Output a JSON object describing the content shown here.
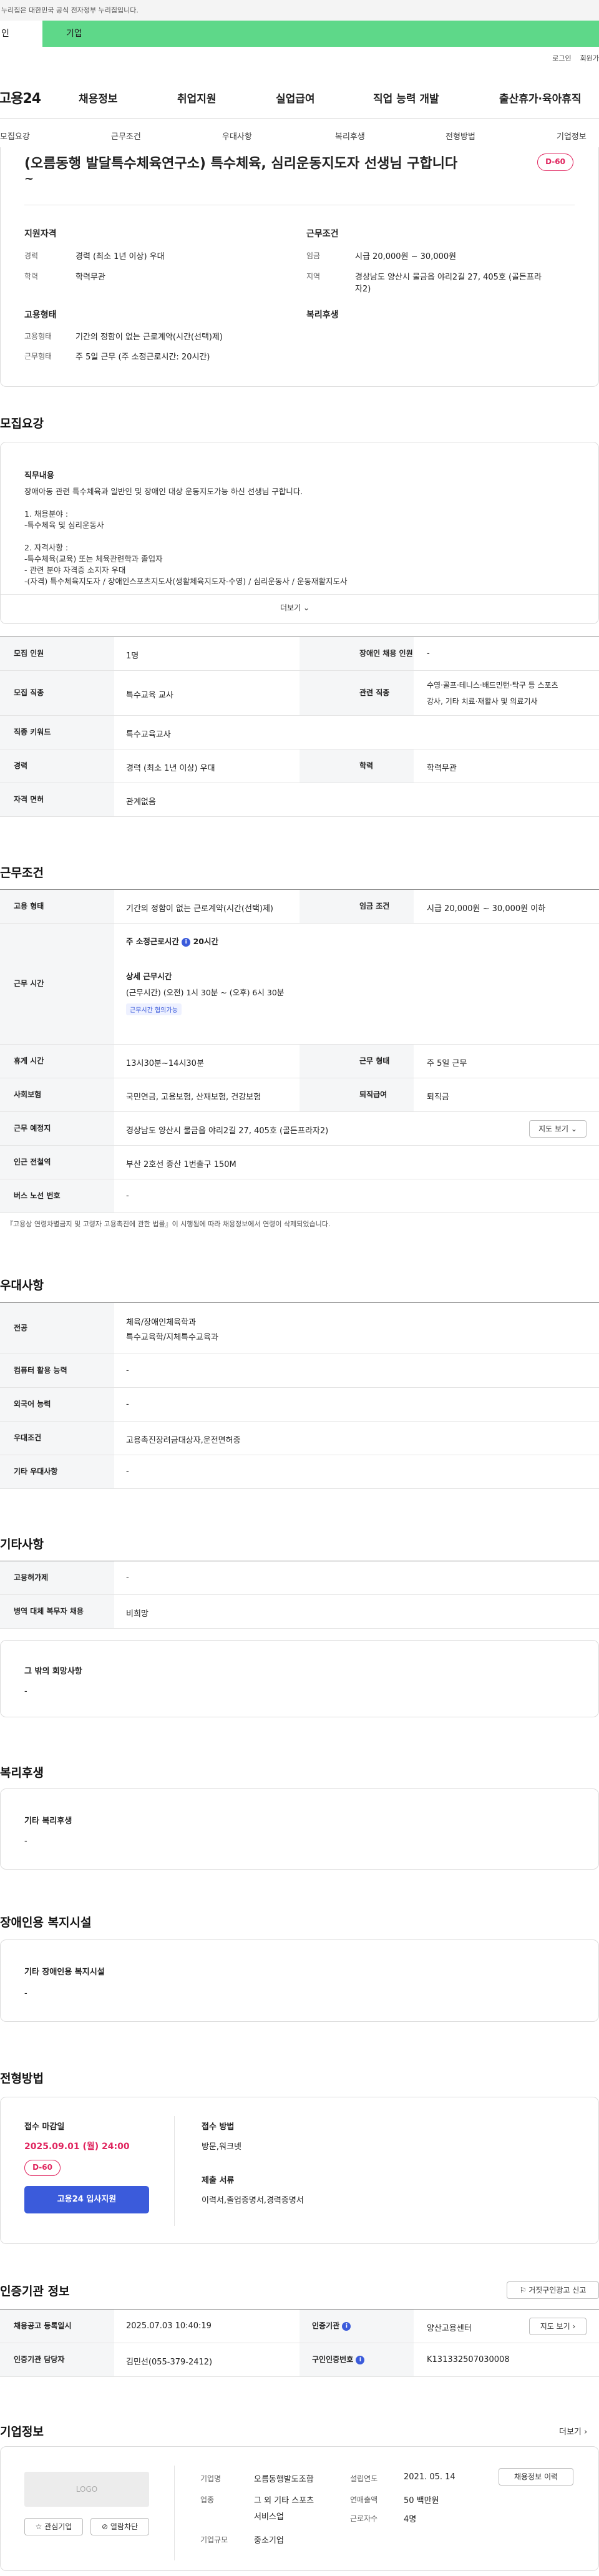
{
  "gov_banner": "누리집은 대한민국 공식 전자정부 누리집입니다.",
  "user_tabs": [
    "인",
    "기업"
  ],
  "top_links": [
    "로그인",
    "회원가"
  ],
  "logo": "고용24",
  "gnb": [
    "채용정보",
    "취업지원",
    "실업급여",
    "직업 능력 개발",
    "출산휴가·육아휴직"
  ],
  "snb": [
    "모집요강",
    "근무조건",
    "우대사항",
    "복리후생",
    "전형방법",
    "기업정보"
  ],
  "job": {
    "title_line1": "(오름동행 발달특수체육연구소) 특수체육, 심리운동지도자 선생님 구합니다",
    "title_line2": "~",
    "dday": "D-60",
    "qual_title": "지원자격",
    "work_title": "근무조건",
    "emp_title": "고용형태",
    "welfare_title": "복리후생",
    "career_label": "경력",
    "career": "경력 (최소 1년 이상) 우대",
    "edu_label": "학력",
    "edu": "학력무관",
    "wage_label": "임금",
    "wage": "시급 20,000원 ~ 30,000원",
    "loc_label": "지역",
    "loc_line1": "경상남도 양산시 물금읍 야리2길 27, 405호 (골든프라",
    "loc_line2": "자2)",
    "emptype_label": "고용형태",
    "emptype": "기간의 정함이 없는 근로계약(시간(선택)제)",
    "worktype_label": "근무형태",
    "worktype": "주 5일 근무 (주 소정근로시간: 20시간)"
  },
  "recruit": {
    "title": "모집요강",
    "duty_title": "직무내용",
    "duty_lines": [
      "장애아동 관련 특수체육과 일반인 및 장애인 대상 운동지도가능 하신 선생님 구합니다.",
      "",
      "1. 채용분야 :",
      "-특수체육 및 심리운동사",
      "",
      "2. 자격사항 :",
      "-특수체육(교육) 또는 체육관련학과 졸업자",
      "- 관련 분야 자격증 소지자 우대",
      "-(자격) 특수체육지도자 / 장애인스포츠지도사(생활체육지도자-수영) / 심리운동사 / 운동재활지도사"
    ],
    "more": "더보기",
    "rows": [
      {
        "k": "모집 인원",
        "v": "1명",
        "k2": "장애인 채용 인원",
        "v2": "-"
      },
      {
        "k": "모집 직종",
        "v": "특수교육 교사",
        "k2": "관련 직종",
        "v2a": "수영·골프·테니스·배드민턴·탁구 등 스포츠",
        "v2b": "강사, 기타 치료·재활사 및 의료기사"
      },
      {
        "k": "직종 키워드",
        "v": "특수교육교사"
      },
      {
        "k": "경력",
        "v": "경력 (최소 1년 이상) 우대",
        "k2": "학력",
        "v2": "학력무관"
      },
      {
        "k": "자격 면허",
        "v": "관계없음"
      }
    ]
  },
  "work": {
    "title": "근무조건",
    "emptype_k": "고용 형태",
    "emptype_v": "기간의 정함이 없는 근로계약(시간(선택)제)",
    "wage_k": "임금 조건",
    "wage_v": "시급 20,000원 ~ 30,000원 이하",
    "hours_k": "근무 시간",
    "hours_week": "주 소정근로시간",
    "hours_week_v": "20시간",
    "hours_detail_t": "상세 근무시간",
    "hours_detail_v": "(근무시간) (오전) 1시 30분 ~ (오후) 6시 30분",
    "hours_tag": "근무시간 협의가능",
    "rest_k": "휴게 시간",
    "rest_v": "13시30분~14시30분",
    "form_k": "근무 형태",
    "form_v": "주 5일 근무",
    "ins_k": "사회보험",
    "ins_v": "국민연금, 고용보험, 산재보험, 건강보험",
    "ret_k": "퇴직급여",
    "ret_v": "퇴직금",
    "place_k": "근무 예정지",
    "place_v": "경상남도 양산시 물금읍 야리2길 27, 405호 (골든프라자2)",
    "map_btn": "지도 보기",
    "sta_k": "인근 전철역",
    "sta_v": "부산 2호선 증산 1번출구 150M",
    "bus_k": "버스 노선 번호",
    "bus_v": "-",
    "note": "『고용상 연령차별금지 및 고령자 고용촉진에 관한 법률』이 시행됨에 따라 채용정보에서 연령이 삭제되었습니다."
  },
  "pref": {
    "title": "우대사항",
    "major_k": "전공",
    "major_v1": "체육/장애인체육학과",
    "major_v2": "특수교육학/지체특수교육과",
    "pc_k": "컴퓨터 활용 능력",
    "pc_v": "-",
    "lang_k": "외국어 능력",
    "lang_v": "-",
    "cond_k": "우대조건",
    "cond_v": "고용촉진장려금대상자,운전면허증",
    "etc_k": "기타 우대사항",
    "etc_v": "-"
  },
  "other": {
    "title": "기타사항",
    "hire_k": "고용허가제",
    "hire_v": "-",
    "mil_k": "병역 대체 복무자 채용",
    "mil_v": "비희망",
    "wish_t": "그 밖의 희망사항",
    "wish_v": "-"
  },
  "welfare": {
    "title": "복리후생",
    "etc_t": "기타 복리후생",
    "etc_v": "-"
  },
  "facility": {
    "title": "장애인용 복지시설",
    "etc_t": "기타 장애인용 복지시설",
    "etc_v": "-"
  },
  "process": {
    "title": "전형방법",
    "deadline_t": "접수 마감일",
    "deadline_v": "2025.09.01 (월) 24:00",
    "dday": "D-60",
    "apply_btn": "고용24 입사지원",
    "method_t": "접수 방법",
    "method_v": "방문,워크넷",
    "docs_t": "제출 서류",
    "docs_v": "이력서,졸업증명서,경력증명서"
  },
  "auth": {
    "title": "인증기관 정보",
    "report_btn": "거짓구인광고 신고",
    "reg_k": "채용공고 등록일시",
    "reg_v": "2025.07.03 10:40:19",
    "org_k": "인증기관",
    "org_v": "양산고용센터",
    "map_btn": "지도 보기",
    "mgr_k": "인증기관 담당자",
    "mgr_v": "김민선(055-379-2412)",
    "no_k": "구인인증번호",
    "no_v": "K131332507030008"
  },
  "company": {
    "title": "기업정보",
    "more": "더보기",
    "logo": "LOGO",
    "fav": "관심기업",
    "block": "열람차단",
    "name_k": "기업명",
    "name_v": "오름동행발도조합",
    "ind_k": "업종",
    "ind_v1": "그 외 기타 스포츠",
    "ind_v2": "서비스업",
    "size_k": "기업규모",
    "size_v": "중소기업",
    "year_k": "설립연도",
    "year_v": "2021. 05. 14",
    "sales_k": "연매출액",
    "sales_v": "50 백만원",
    "emp_k": "근로자수",
    "emp_v": "4명",
    "history_btn": "채용정보 이력"
  }
}
